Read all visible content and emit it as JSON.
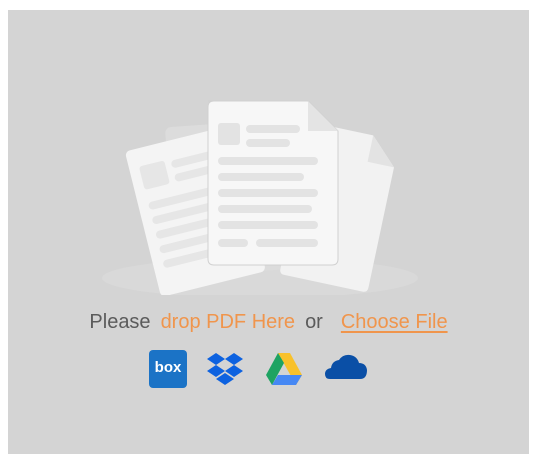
{
  "dropzone": {
    "please_label": "Please",
    "drop_label": "drop PDF Here",
    "or_label": "or",
    "choose_file_label": "Choose File"
  },
  "sources": {
    "box_label": "box",
    "icons": [
      "box-icon",
      "dropbox-icon",
      "google-drive-icon",
      "onedrive-icon"
    ]
  },
  "colors": {
    "background": "#d4d4d4",
    "accent": "#f0954c",
    "text": "#5b5b5b",
    "box": "#1b73c6",
    "dropbox": "#0d62e0",
    "onedrive": "#0a4fa6"
  }
}
